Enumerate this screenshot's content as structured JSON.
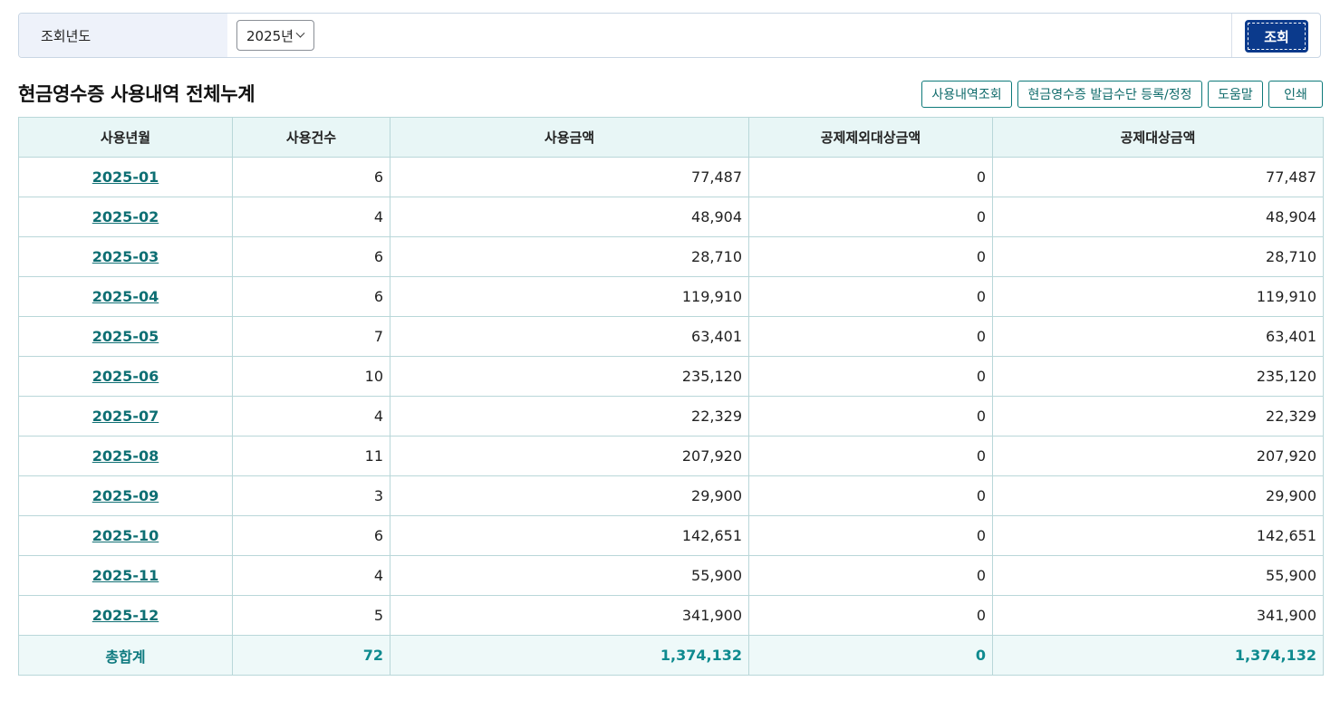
{
  "search": {
    "label": "조회년도",
    "year_selected": "2025년",
    "button_label": "조회"
  },
  "section": {
    "title": "현금영수증 사용내역 전체누계",
    "actions": [
      "사용내역조회",
      "현금영수증 발급수단 등록/정정",
      "도움말",
      "인쇄"
    ]
  },
  "table": {
    "headers": [
      "사용년월",
      "사용건수",
      "사용금액",
      "공제제외대상금액",
      "공제대상금액"
    ],
    "rows": [
      {
        "month": "2025-01",
        "count": "6",
        "amount": "77,487",
        "excluded": "0",
        "eligible": "77,487"
      },
      {
        "month": "2025-02",
        "count": "4",
        "amount": "48,904",
        "excluded": "0",
        "eligible": "48,904"
      },
      {
        "month": "2025-03",
        "count": "6",
        "amount": "28,710",
        "excluded": "0",
        "eligible": "28,710"
      },
      {
        "month": "2025-04",
        "count": "6",
        "amount": "119,910",
        "excluded": "0",
        "eligible": "119,910"
      },
      {
        "month": "2025-05",
        "count": "7",
        "amount": "63,401",
        "excluded": "0",
        "eligible": "63,401"
      },
      {
        "month": "2025-06",
        "count": "10",
        "amount": "235,120",
        "excluded": "0",
        "eligible": "235,120"
      },
      {
        "month": "2025-07",
        "count": "4",
        "amount": "22,329",
        "excluded": "0",
        "eligible": "22,329"
      },
      {
        "month": "2025-08",
        "count": "11",
        "amount": "207,920",
        "excluded": "0",
        "eligible": "207,920"
      },
      {
        "month": "2025-09",
        "count": "3",
        "amount": "29,900",
        "excluded": "0",
        "eligible": "29,900"
      },
      {
        "month": "2025-10",
        "count": "6",
        "amount": "142,651",
        "excluded": "0",
        "eligible": "142,651"
      },
      {
        "month": "2025-11",
        "count": "4",
        "amount": "55,900",
        "excluded": "0",
        "eligible": "55,900"
      },
      {
        "month": "2025-12",
        "count": "5",
        "amount": "341,900",
        "excluded": "0",
        "eligible": "341,900"
      }
    ],
    "total": {
      "label": "총합계",
      "count": "72",
      "amount": "1,374,132",
      "excluded": "0",
      "eligible": "1,374,132"
    }
  },
  "colors": {
    "primary_button": "#0b3a8c",
    "accent_teal": "#0e7a7a",
    "header_bg": "#e8f6f6",
    "label_bg": "#eef2fa"
  }
}
